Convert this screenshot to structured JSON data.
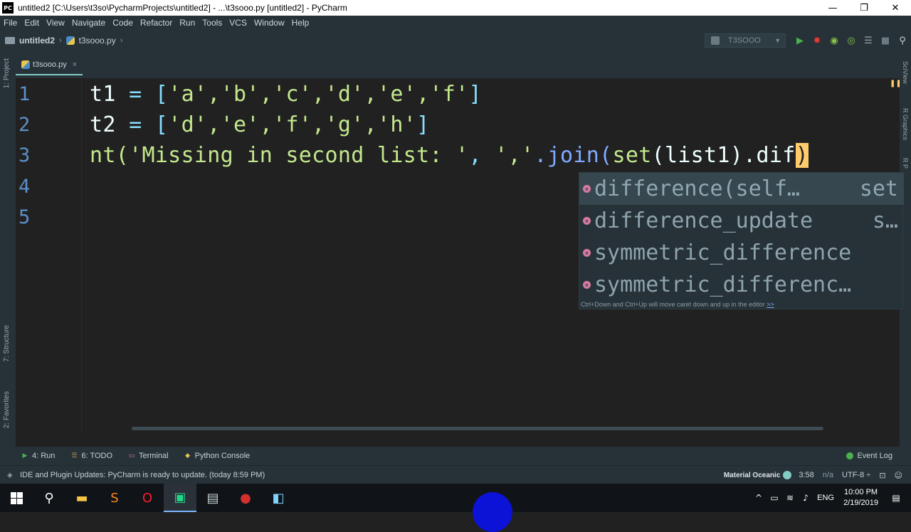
{
  "window": {
    "title": "untitled2 [C:\\Users\\t3so\\PycharmProjects\\untitled2] - ...\\t3sooo.py [untitled2] - PyCharm",
    "app_icon_text": "PC",
    "minimize": "—",
    "maximize": "❐",
    "close": "✕"
  },
  "menu": [
    "File",
    "Edit",
    "View",
    "Navigate",
    "Code",
    "Refactor",
    "Run",
    "Tools",
    "VCS",
    "Window",
    "Help"
  ],
  "nav": {
    "project": "untitled2",
    "file": "t3sooo.py",
    "run_config": "T3SOOO"
  },
  "left_strip": {
    "project_label": "1: Project",
    "structure_label": "7: Structure",
    "favorites_label": "2: Favorites"
  },
  "right_strip": {
    "sciview_label": "SciView",
    "rgraphics_label": "R Graphics",
    "rp_label": "R P"
  },
  "tab": {
    "label": "t3sooo.py",
    "close": "×"
  },
  "editor": {
    "line_numbers": [
      "1",
      "2",
      "3",
      "4",
      "5"
    ],
    "line1": {
      "var": "t1",
      "op": " = ",
      "open": "[",
      "items": "'a','b','c','d','e','f'",
      "close": "]"
    },
    "line2": {
      "var": "t2",
      "op": " = ",
      "open": "[",
      "items": "'d','e','f','g','h'",
      "close": "]"
    },
    "line3": {
      "prefix": "nt(",
      "str1": "'Missing in second list: '",
      "sep": ", ",
      "str2": "','",
      "join": ".join(",
      "setfn": "set",
      "arg": "(list1).dif",
      "caret": ")"
    }
  },
  "completion": {
    "items": [
      {
        "name": "difference(self…",
        "type": "set"
      },
      {
        "name": "difference_update",
        "type": "s…"
      },
      {
        "name": "symmetric_difference",
        "type": ""
      },
      {
        "name": "symmetric_differenc…",
        "type": ""
      }
    ],
    "hint": "Ctrl+Down and Ctrl+Up will move caret down and up in the editor",
    "hint_more": ">>"
  },
  "bottom_tools": {
    "run": "4: Run",
    "todo": "6: TODO",
    "terminal": "Terminal",
    "python_console": "Python Console",
    "event_log": "Event Log"
  },
  "status": {
    "message": "IDE and Plugin Updates: PyCharm is ready to update. (today 8:59 PM)",
    "theme": "Material Oceanic",
    "position": "3:58",
    "na": "n/a",
    "encoding": "UTF-8 ÷"
  },
  "taskbar": {
    "lang": "ENG",
    "time": "10:00 PM",
    "date": "2/19/2019"
  },
  "colors": {
    "background": "#212121",
    "panel": "#263238",
    "accent": "#80cbc4",
    "string": "#c3e88d",
    "function": "#82aaff",
    "operator": "#89ddff",
    "line_number": "#5c8fc9"
  }
}
